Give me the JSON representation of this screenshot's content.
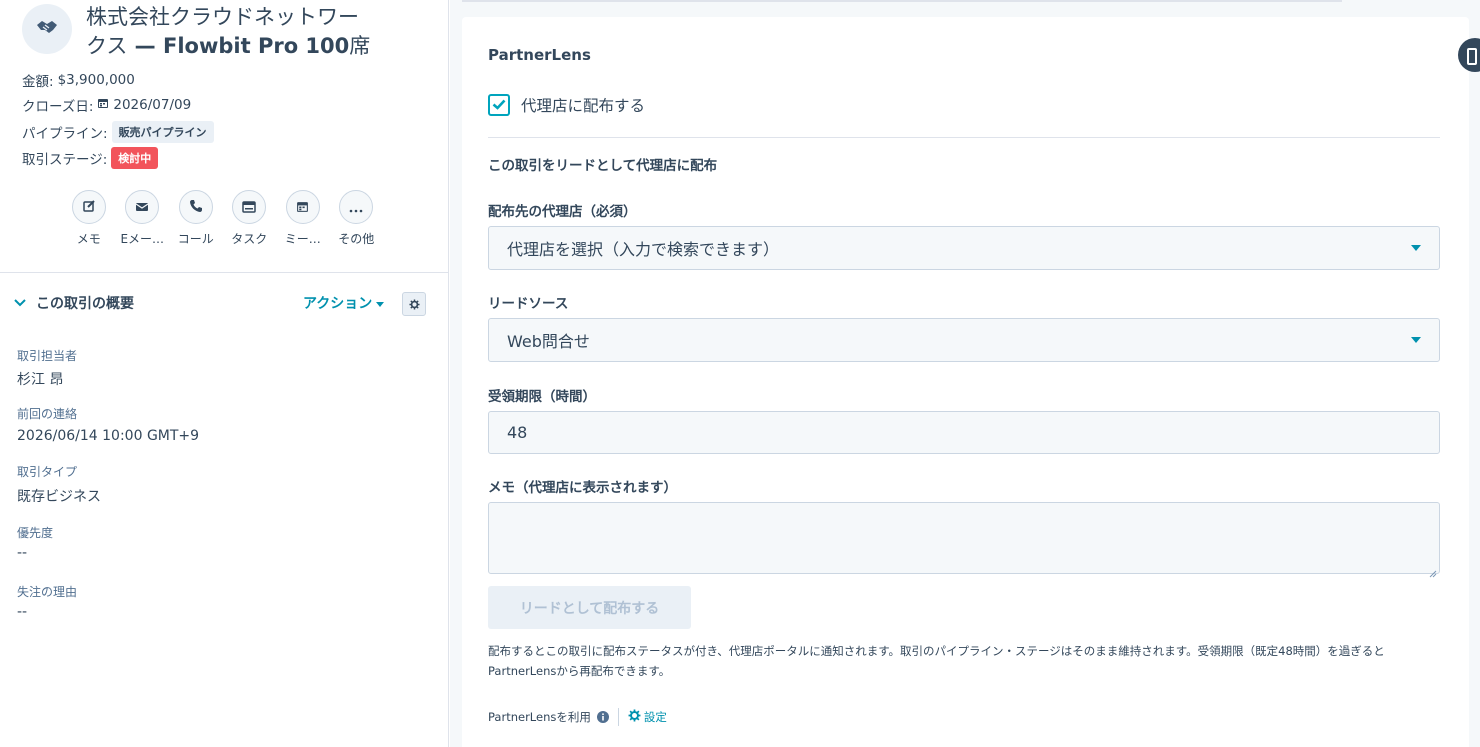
{
  "deal": {
    "title_line1": "株式会社クラウドネットワー",
    "title_line2a": "クス",
    "title_line2b": " — Flowbit Pro 100",
    "title_line2c": "席",
    "amount_label": "金額:",
    "amount_value": "$3,900,000",
    "close_label": "クローズ日:",
    "close_value": "2026/07/09",
    "pipeline_label": "パイプライン:",
    "pipeline_value": "販売パイプライン",
    "stage_label": "取引ステージ:",
    "stage_value": "検討中"
  },
  "quick_actions": [
    {
      "label": "メモ",
      "icon": "note-icon"
    },
    {
      "label": "Eメー…",
      "icon": "email-icon"
    },
    {
      "label": "コール",
      "icon": "call-icon"
    },
    {
      "label": "タスク",
      "icon": "task-icon"
    },
    {
      "label": "ミー…",
      "icon": "meeting-icon"
    },
    {
      "label": "その他",
      "icon": "more-icon"
    }
  ],
  "about": {
    "header": "この取引の概要",
    "actions_label": "アクション",
    "fields": [
      {
        "label": "取引担当者",
        "value": "杉江 昂"
      },
      {
        "label": "前回の連絡",
        "value": "2026/06/14 10:00 GMT+9"
      },
      {
        "label": "取引タイプ",
        "value": "既存ビジネス"
      },
      {
        "label": "優先度",
        "value": "--"
      },
      {
        "label": "失注の理由",
        "value": "--"
      }
    ]
  },
  "partnerlens": {
    "title": "PartnerLens",
    "checkbox_label": "代理店に配布する",
    "checkbox_checked": true,
    "section_header": "この取引をリードとして代理店に配布",
    "agency_label": "配布先の代理店（必須）",
    "agency_placeholder": "代理店を選択（入力で検索できます）",
    "source_label": "リードソース",
    "source_value": "Web問合せ",
    "deadline_label": "受領期限（時間）",
    "deadline_value": "48",
    "memo_label": "メモ（代理店に表示されます）",
    "memo_value": "",
    "submit_label": "リードとして配布する",
    "help_text": "配布するとこの取引に配布ステータスが付き、代理店ポータルに通知されます。取引のパイプライン・ステージはそのまま維持されます。受領期限（既定48時間）を過ぎるとPartnerLensから再配布できます。",
    "footer_using": "PartnerLensを利用",
    "footer_settings": "設定"
  },
  "colors": {
    "accent": "#0091ae",
    "stage_badge": "#f2545b",
    "checkbox": "#00a4bd"
  }
}
